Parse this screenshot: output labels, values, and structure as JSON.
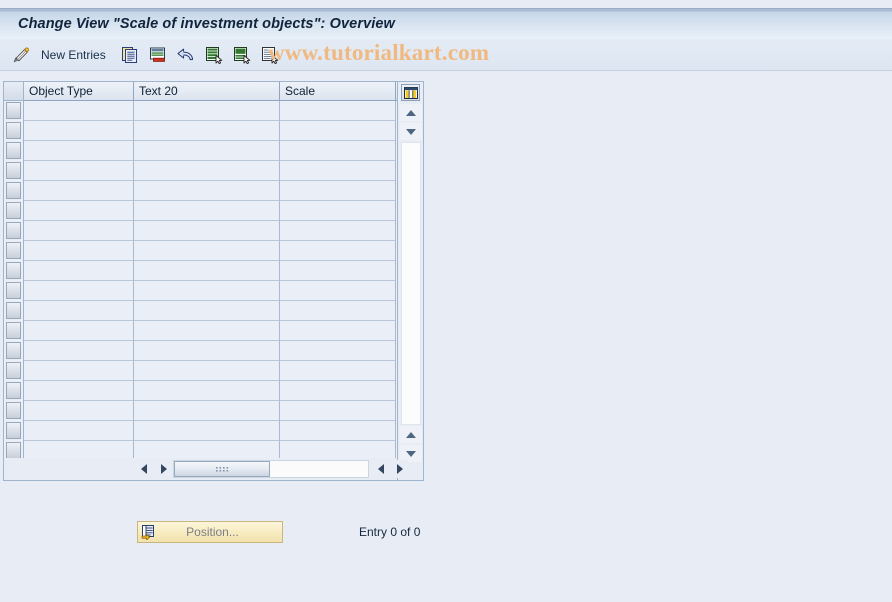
{
  "window": {
    "title": "Change View \"Scale of investment objects\": Overview"
  },
  "toolbar": {
    "buttons": [
      {
        "name": "display-change-toggle",
        "icon": "pencil-icon",
        "tooltip": "Display/Change"
      }
    ],
    "new_entries_label": "New Entries",
    "action_buttons": [
      {
        "name": "copy-as-button",
        "icon": "copy-icon"
      },
      {
        "name": "delete-button",
        "icon": "delete-row-icon"
      },
      {
        "name": "undo-button",
        "icon": "undo-arrow-icon"
      },
      {
        "name": "select-all-button",
        "icon": "select-all-icon"
      },
      {
        "name": "select-block-button",
        "icon": "select-block-icon"
      },
      {
        "name": "deselect-all-button",
        "icon": "deselect-all-icon"
      }
    ]
  },
  "watermark": {
    "text": "www.tutorialkart.com",
    "color": "#f0b982"
  },
  "table": {
    "columns": [
      {
        "key": "object_type",
        "label": "Object Type",
        "width": 110
      },
      {
        "key": "text_20",
        "label": "Text 20",
        "width": 146
      },
      {
        "key": "scale",
        "label": "Scale",
        "width": 116
      }
    ],
    "rows": [
      {
        "object_type": "",
        "text_20": "",
        "scale": ""
      },
      {
        "object_type": "",
        "text_20": "",
        "scale": ""
      },
      {
        "object_type": "",
        "text_20": "",
        "scale": ""
      },
      {
        "object_type": "",
        "text_20": "",
        "scale": ""
      },
      {
        "object_type": "",
        "text_20": "",
        "scale": ""
      },
      {
        "object_type": "",
        "text_20": "",
        "scale": ""
      },
      {
        "object_type": "",
        "text_20": "",
        "scale": ""
      },
      {
        "object_type": "",
        "text_20": "",
        "scale": ""
      },
      {
        "object_type": "",
        "text_20": "",
        "scale": ""
      },
      {
        "object_type": "",
        "text_20": "",
        "scale": ""
      },
      {
        "object_type": "",
        "text_20": "",
        "scale": ""
      },
      {
        "object_type": "",
        "text_20": "",
        "scale": ""
      },
      {
        "object_type": "",
        "text_20": "",
        "scale": ""
      },
      {
        "object_type": "",
        "text_20": "",
        "scale": ""
      },
      {
        "object_type": "",
        "text_20": "",
        "scale": ""
      },
      {
        "object_type": "",
        "text_20": "",
        "scale": ""
      },
      {
        "object_type": "",
        "text_20": "",
        "scale": ""
      },
      {
        "object_type": "",
        "text_20": "",
        "scale": ""
      }
    ],
    "column_config_icon": "table-columns-icon"
  },
  "scrollbars": {
    "vertical": {
      "up_icon": "triangle-up-icon",
      "down_icon": "triangle-down-icon"
    },
    "horizontal": {
      "left_icon": "triangle-left-icon",
      "right_icon": "triangle-right-icon"
    }
  },
  "footer": {
    "position_button_label": "Position...",
    "position_button_icon": "position-list-icon",
    "entry_counter": "Entry 0 of 0"
  },
  "colors": {
    "page_background": "#e7ecf5",
    "title_bar_top": "#a9bcd4",
    "grid_background": "#eaeff7",
    "grid_line": "#a8b9d0",
    "button_yellow": "#f7ecc1"
  }
}
